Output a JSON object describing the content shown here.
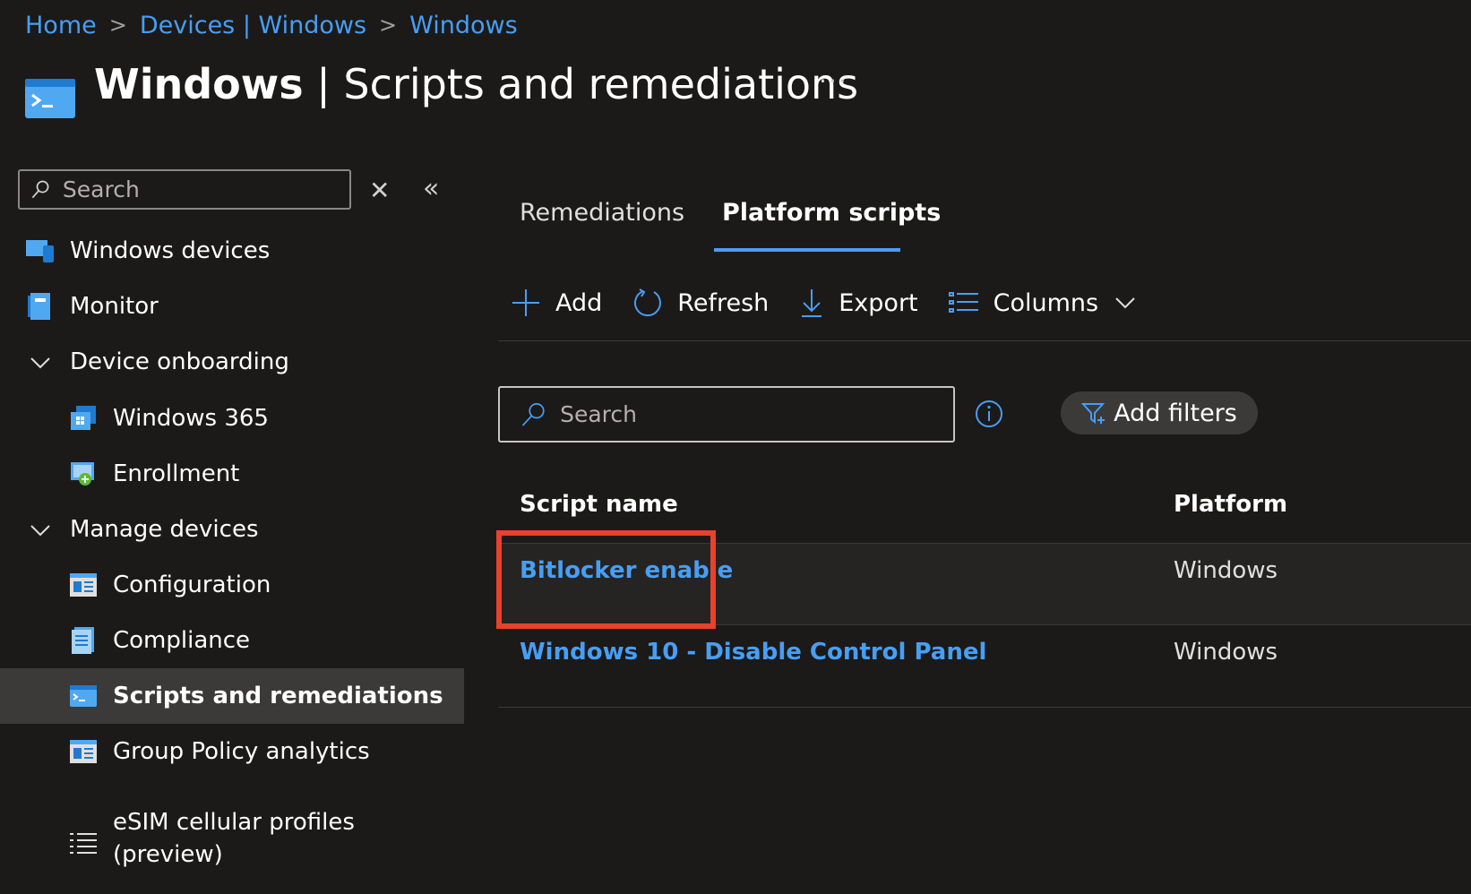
{
  "breadcrumb": {
    "items": [
      "Home",
      "Devices | Windows",
      "Windows"
    ]
  },
  "header": {
    "title_bold": "Windows",
    "title_rest": " | Scripts and remediations",
    "more_label": "···"
  },
  "sidebar": {
    "search_placeholder": "Search",
    "items": [
      {
        "label": "Windows devices"
      },
      {
        "label": "Monitor"
      },
      {
        "label": "Device onboarding"
      },
      {
        "label": "Windows 365"
      },
      {
        "label": "Enrollment"
      },
      {
        "label": "Manage devices"
      },
      {
        "label": "Configuration"
      },
      {
        "label": "Compliance"
      },
      {
        "label": "Scripts and remediations"
      },
      {
        "label": "Group Policy analytics"
      },
      {
        "label": "eSIM cellular profiles",
        "label2": "(preview)"
      }
    ]
  },
  "tabs": [
    {
      "label": "Remediations"
    },
    {
      "label": "Platform scripts"
    }
  ],
  "toolbar": {
    "add": "Add",
    "refresh": "Refresh",
    "export": "Export",
    "columns": "Columns"
  },
  "filter": {
    "search_placeholder": "Search",
    "add_filters": "Add filters"
  },
  "table": {
    "headers": [
      "Script name",
      "Platform"
    ],
    "rows": [
      {
        "name": "Bitlocker enable",
        "platform": "Windows"
      },
      {
        "name": "Windows 10 - Disable Control Panel",
        "platform": "Windows"
      }
    ]
  },
  "colors": {
    "accent": "#479ef5",
    "highlight": "#e8412c",
    "background": "#1b1a19"
  }
}
